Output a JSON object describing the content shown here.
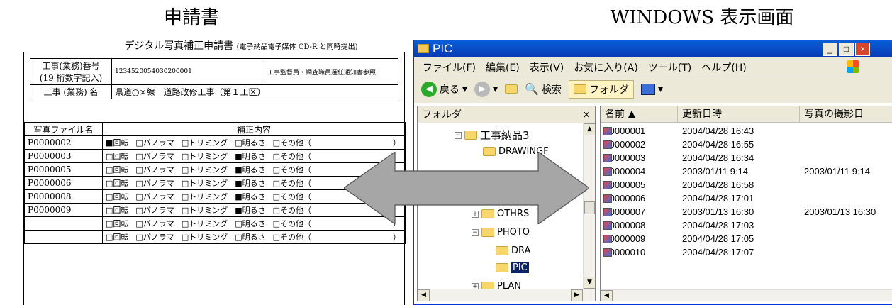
{
  "headings": {
    "left": "申請書",
    "right": "WINDOWS 表示画面"
  },
  "form": {
    "title": "デジタル写真補正申請書",
    "title_note": "(電子納品電子媒体 CD-R と同時提出)",
    "project_no_label": "工事(業務)番号",
    "project_no_sub": "(19 桁数字記入)",
    "project_no_value": "1234520054030200001",
    "project_no_ref": "工事監督員・調査職員選任通知書参照",
    "project_name_label": "工事 (業務) 名",
    "project_name_value": "県道○×線　道路改修工事（第１工区）",
    "col_file": "写真ファイル名",
    "col_content": "補正内容",
    "rows": [
      {
        "file": "P0000002",
        "opts": [
          "■回転",
          "□パノラマ",
          "□トリミング",
          "□明るさ",
          "□その他（"
        ]
      },
      {
        "file": "P0000003",
        "opts": [
          "□回転",
          "□パノラマ",
          "□トリミング",
          "■明るさ",
          "□その他（"
        ]
      },
      {
        "file": "P0000005",
        "opts": [
          "□回転",
          "□パノラマ",
          "□トリミング",
          "■明るさ",
          "□その他（"
        ]
      },
      {
        "file": "P0000006",
        "opts": [
          "□回転",
          "□パノラマ",
          "□トリミング",
          "■明るさ",
          "□その他（"
        ]
      },
      {
        "file": "P0000008",
        "opts": [
          "□回転",
          "□パノラマ",
          "□トリミング",
          "■明るさ",
          "□その他（"
        ]
      },
      {
        "file": "P0000009",
        "opts": [
          "□回転",
          "□パノラマ",
          "□トリミング",
          "■明るさ",
          "□その他（"
        ]
      },
      {
        "file": "",
        "opts": [
          "□回転",
          "□パノラマ",
          "□トリミング",
          "□明るさ",
          "□その他（"
        ]
      },
      {
        "file": "",
        "opts": [
          "□回転",
          "□パノラマ",
          "□トリミング",
          "□明るさ",
          "□その他（"
        ]
      }
    ],
    "close_paren": "）"
  },
  "window": {
    "title": "PIC",
    "controls": {
      "min": "_",
      "max": "□",
      "close": "×"
    },
    "menu": [
      "ファイル(F)",
      "編集(E)",
      "表示(V)",
      "お気に入り(A)",
      "ツール(T)",
      "ヘルプ(H)"
    ],
    "toolbar": {
      "back": "戻る",
      "search": "検索",
      "folders": "フォルダ"
    },
    "folder_pane": {
      "header": "フォルダ",
      "close": "×",
      "items": [
        {
          "label": "工事納品3",
          "pm": "⊟"
        },
        {
          "label": "DRAWINGF",
          "pm": ""
        },
        {
          "label": "OTHRS",
          "pm": "⊞"
        },
        {
          "label": "PHOTO",
          "pm": "⊟"
        },
        {
          "label": "DRA",
          "pm": ""
        },
        {
          "label": "PIC",
          "pm": "",
          "selected": true
        },
        {
          "label": "PLAN",
          "pm": "⊞"
        }
      ]
    },
    "file_pane": {
      "columns": [
        "名前 ▲",
        "更新日時",
        "写真の撮影日"
      ],
      "files": [
        {
          "name": "P0000001",
          "date": "2004/04/28 16:43",
          "shot": ""
        },
        {
          "name": "P0000002",
          "date": "2004/04/28 16:55",
          "shot": ""
        },
        {
          "name": "P0000003",
          "date": "2004/04/28 16:34",
          "shot": ""
        },
        {
          "name": "P0000004",
          "date": "2003/01/11 9:14",
          "shot": "2003/01/11 9:14"
        },
        {
          "name": "P0000005",
          "date": "2004/04/28 16:58",
          "shot": ""
        },
        {
          "name": "P0000006",
          "date": "2004/04/28 17:01",
          "shot": ""
        },
        {
          "name": "P0000007",
          "date": "2003/01/13 16:30",
          "shot": "2003/01/13 16:30"
        },
        {
          "name": "P0000008",
          "date": "2004/04/28 17:03",
          "shot": ""
        },
        {
          "name": "P0000009",
          "date": "2004/04/28 17:05",
          "shot": ""
        },
        {
          "name": "P0000010",
          "date": "2004/04/28 17:07",
          "shot": ""
        }
      ]
    }
  },
  "colors": {
    "titlebar": "#0a5fd8",
    "selection": "#0a246a",
    "arrow": "#a6a6a6"
  }
}
